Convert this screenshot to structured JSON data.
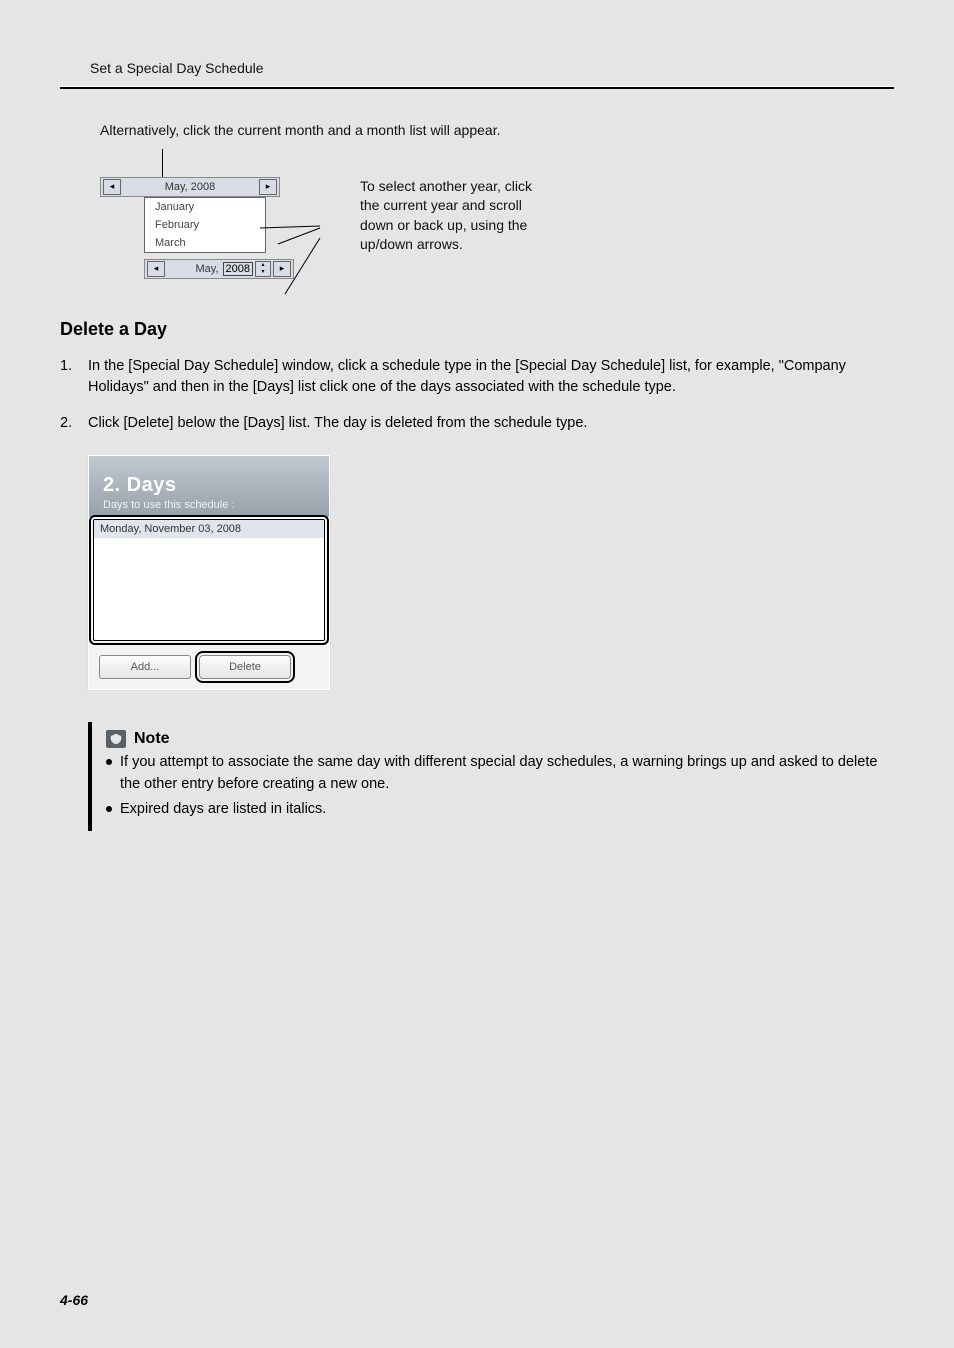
{
  "header": {
    "title": "Set a Special Day Schedule"
  },
  "intro": {
    "text": "Alternatively, click the current month and a month list will appear."
  },
  "calendar": {
    "top_month": "May, 2008",
    "months": [
      "January",
      "February",
      "March"
    ],
    "year_label": "May,",
    "year_value": "2008"
  },
  "annotation": {
    "text": "To select another year, click the current year and scroll down or back up, using the up/down arrows."
  },
  "section": {
    "heading": "Delete a Day",
    "steps": [
      "In the [Special Day Schedule] window, click a schedule type in the [Special Day Schedule] list, for example, \"Company Holidays\" and then in the [Days] list click one of the days associated with the schedule type.",
      "Click [Delete] below the [Days] list. The day is deleted from the schedule type."
    ]
  },
  "days_panel": {
    "title": "2. Days",
    "subtitle": "Days to use this schedule :",
    "row": "Monday, November 03, 2008",
    "add_label": "Add...",
    "delete_label": "Delete"
  },
  "note": {
    "label": "Note",
    "items": [
      "If you attempt to associate the same day with different special day schedules, a warning brings up and asked to delete the other entry before creating a new one.",
      "Expired days are listed in italics."
    ]
  },
  "footer": {
    "page": "4-66"
  }
}
